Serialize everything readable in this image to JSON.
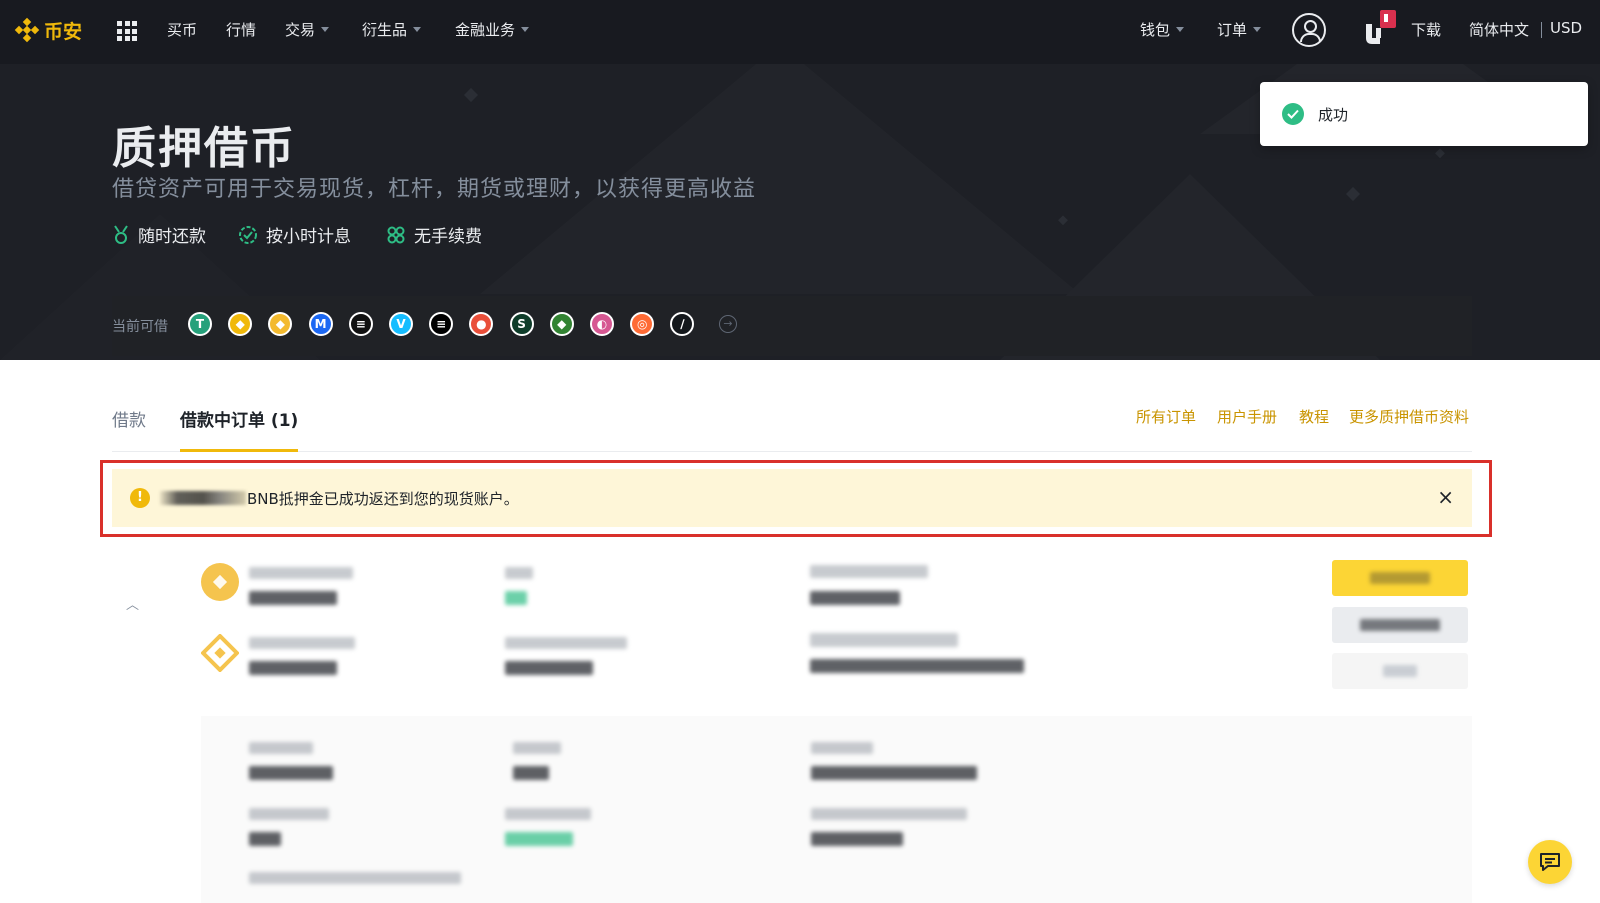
{
  "nav": {
    "brand": "币安",
    "items": [
      {
        "label": "买币",
        "dropdown": false
      },
      {
        "label": "行情",
        "dropdown": false
      },
      {
        "label": "交易",
        "dropdown": true
      },
      {
        "label": "衍生品",
        "dropdown": true
      },
      {
        "label": "金融业务",
        "dropdown": true
      }
    ],
    "wallet": "钱包",
    "orders": "订单",
    "download": "下载",
    "language": "简体中文",
    "currency": "USD"
  },
  "hero": {
    "title": "质押借币",
    "subtitle": "借贷资产可用于交易现货，杠杆，期货或理财，以获得更高收益",
    "features": [
      "随时还款",
      "按小时计息",
      "无手续费"
    ],
    "borrowable_label": "当前可借",
    "coins": [
      {
        "icon": "usdt-coin-icon",
        "glyph": "T",
        "color": "#26a17b"
      },
      {
        "icon": "busd-coin-icon",
        "glyph": "◆",
        "color": "#f0b90b"
      },
      {
        "icon": "bnb-coin-icon",
        "glyph": "◆",
        "color": "#f3ba2f"
      },
      {
        "icon": "mask-coin-icon",
        "glyph": "M",
        "color": "#1c68f3"
      },
      {
        "icon": "solana-coin-icon",
        "glyph": "≡",
        "color": "#111111"
      },
      {
        "icon": "vechain-coin-icon",
        "glyph": "V",
        "color": "#15bdff"
      },
      {
        "icon": "ethena-coin-icon",
        "glyph": "≡",
        "color": "#000000"
      },
      {
        "icon": "pie-coin-icon",
        "glyph": "●",
        "color": "#e94f3a"
      },
      {
        "icon": "sidus-coin-icon",
        "glyph": "S",
        "color": "#0f3d2a"
      },
      {
        "icon": "ethereum-classic-coin-icon",
        "glyph": "◆",
        "color": "#328332"
      },
      {
        "icon": "sushi-coin-icon",
        "glyph": "◐",
        "color": "#d65892"
      },
      {
        "icon": "swell-coin-icon",
        "glyph": "◎",
        "color": "#ff6b35"
      },
      {
        "icon": "stellar-coin-icon",
        "glyph": "∕",
        "color": "#14181c"
      }
    ]
  },
  "toast": {
    "text": "成功"
  },
  "tabs": {
    "items": [
      {
        "label": "借款",
        "active": false
      },
      {
        "label": "借款中订单 (1)",
        "active": true
      }
    ],
    "links": [
      "所有订单",
      "用户手册",
      "教程",
      "更多质押借币资料"
    ]
  },
  "alert": {
    "text": "BNB抵押金已成功返还到您的现货账户。"
  },
  "colors": {
    "brand": "#f0b90b",
    "nav_bg": "#181a20",
    "hero_bg": "#1e2026",
    "alert_bg": "#fef6d8",
    "alert_border": "#d9302a",
    "success": "#2ebd85",
    "link": "#c99400"
  }
}
